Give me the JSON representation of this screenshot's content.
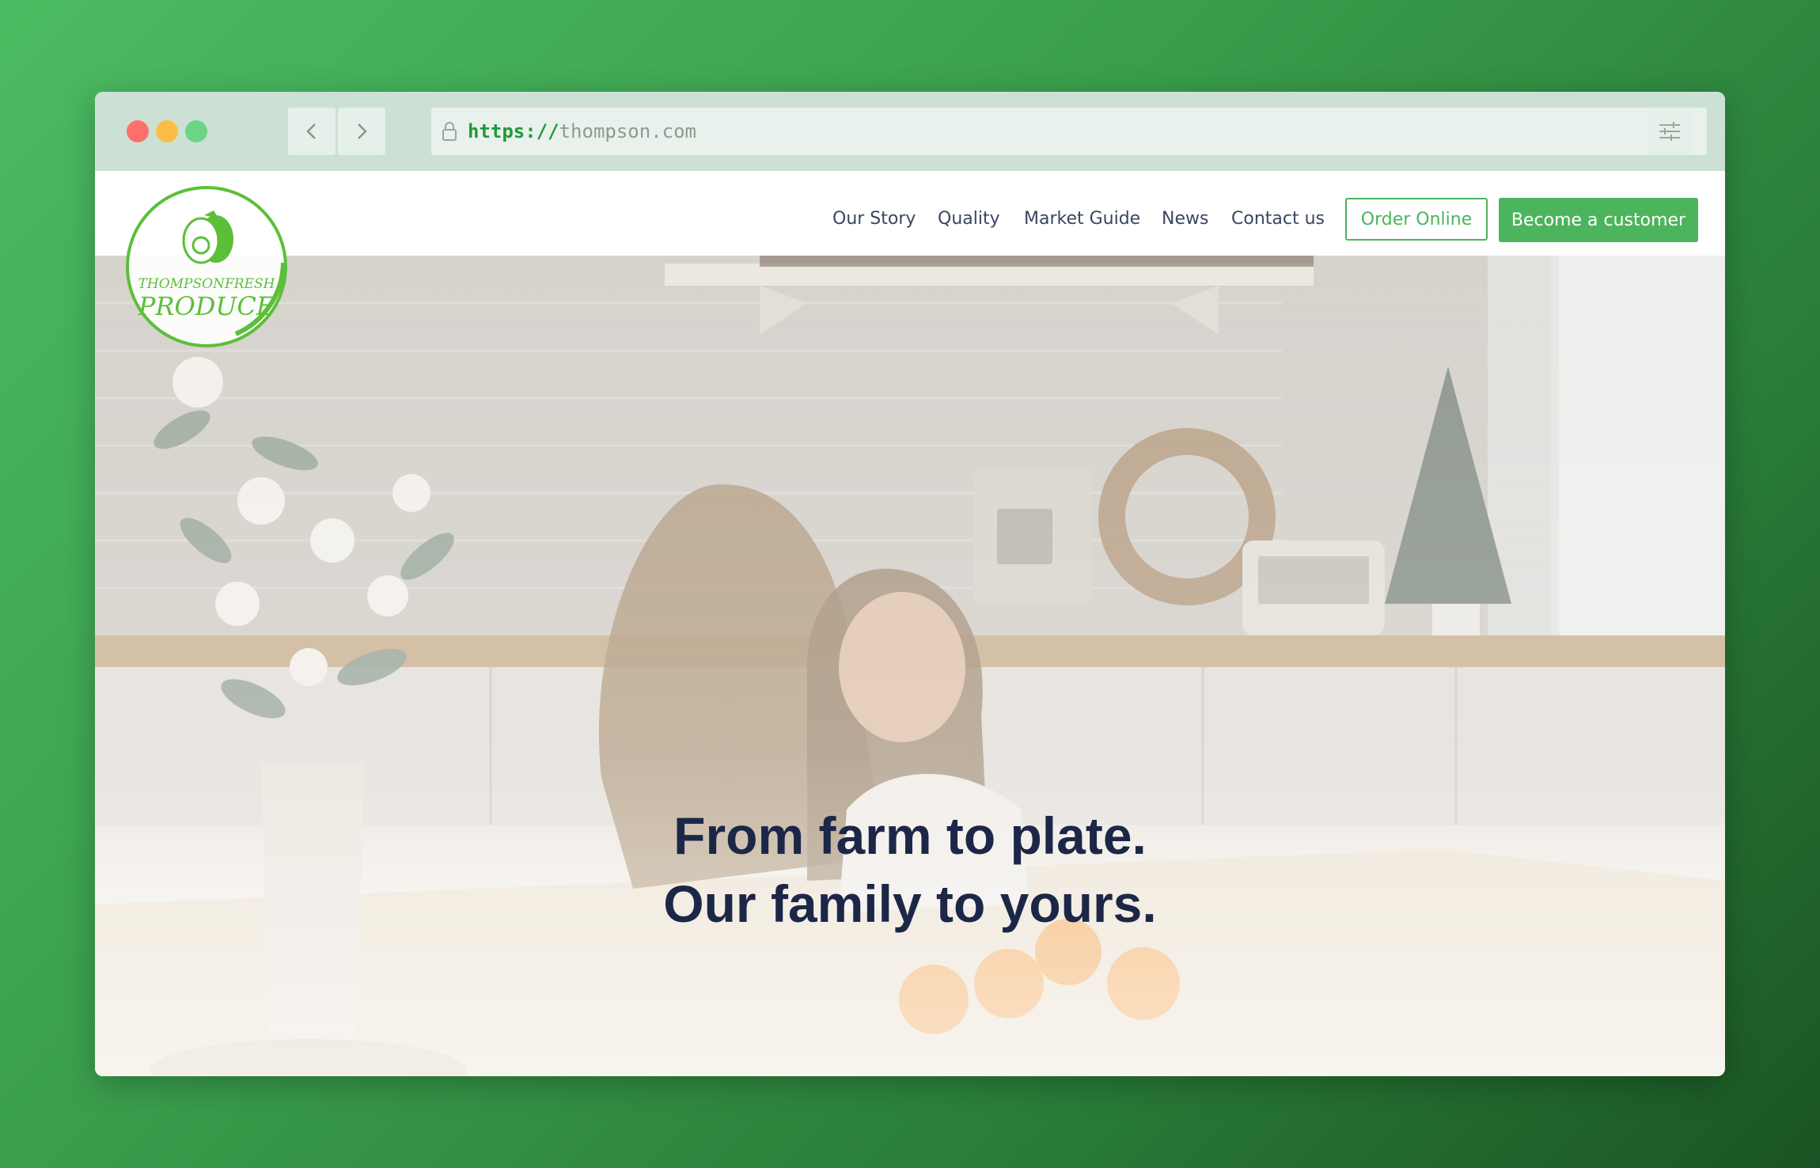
{
  "browser": {
    "url_scheme": "https://",
    "url_host": "thompson.com",
    "icons": [
      "lock-icon",
      "chevron-left-icon",
      "chevron-right-icon",
      "sliders-icon"
    ]
  },
  "header": {
    "logo_text_top": "THOMPSONFRESH",
    "logo_text_bottom": "PRODUCE",
    "nav": [
      {
        "label": "Our Story"
      },
      {
        "label": "Quality"
      },
      {
        "label": "Market Guide"
      },
      {
        "label": "News"
      },
      {
        "label": "Contact us"
      }
    ],
    "order_label": "Order Online",
    "customer_label": "Become a customer"
  },
  "hero": {
    "line1": "From farm to plate.",
    "line2": "Our family to yours."
  },
  "colors": {
    "accent_green": "#4cb45c",
    "headline_navy": "#1c2748",
    "chrome_bg": "#cde0d4"
  }
}
